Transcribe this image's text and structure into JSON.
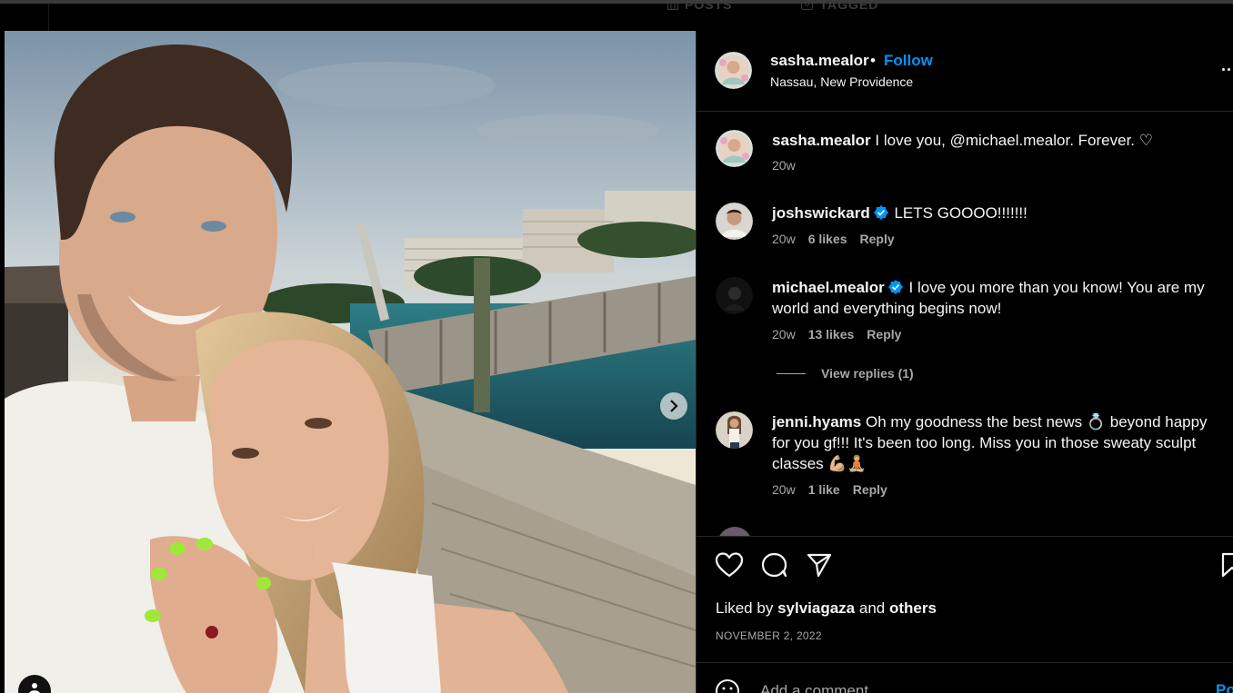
{
  "background": {
    "tabs": [
      {
        "label": "POSTS",
        "icon": "grid-icon"
      },
      {
        "label": "TAGGED",
        "icon": "tagged-icon"
      }
    ]
  },
  "post": {
    "author": "sasha.mealor",
    "separator": "•",
    "follow_label": "Follow",
    "location": "Nassau, New Providence",
    "caption": {
      "username": "sasha.mealor",
      "text": "I love you, @michael.mealor. Forever. ♡",
      "time": "20w"
    },
    "comments": [
      {
        "username": "joshswickard",
        "verified": true,
        "text": "LETS GOOOO!!!!!!!",
        "time": "20w",
        "likes": "6 likes",
        "reply_label": "Reply"
      },
      {
        "username": "michael.mealor",
        "verified": true,
        "text": "I love you more than you know! You are my world and everything begins now!",
        "time": "20w",
        "likes": "13 likes",
        "reply_label": "Reply",
        "view_replies": "View replies (1)"
      },
      {
        "username": "jenni.hyams",
        "verified": false,
        "text": "Oh my goodness the best news 💍 beyond happy for you gf!!! It's been too long. Miss you in those sweaty sculpt classes 💪🏼🧘🏼",
        "time": "20w",
        "likes": "1 like",
        "reply_label": "Reply"
      }
    ],
    "liked_by": {
      "prefix": "Liked by",
      "user": "sylviagaza",
      "joiner": "and",
      "others": "others"
    },
    "date": "NOVEMBER 2, 2022",
    "add_comment_placeholder": "Add a comment...",
    "post_label": "Post"
  },
  "icons": {
    "like": "heart-icon",
    "comment": "comment-icon",
    "share": "send-icon",
    "save": "bookmark-icon",
    "more": "more-icon",
    "next": "chevron-right-icon",
    "emoji": "emoji-icon",
    "tag": "user-tag-icon"
  },
  "colors": {
    "accent": "#0095f6",
    "verified": "#0095f6",
    "muted": "#a8a8a8",
    "background": "#000000",
    "divider": "#262626"
  }
}
